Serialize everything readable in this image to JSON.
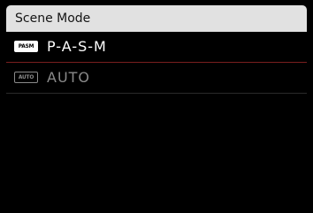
{
  "menu": {
    "title": "Scene Mode",
    "items": [
      {
        "icon": "PASM",
        "label": "P-A-S-M",
        "selected": true
      },
      {
        "icon": "AUTO",
        "label": "AUTO",
        "selected": false
      }
    ]
  },
  "colors": {
    "header_bg": "#e1e1e1",
    "background": "#000000",
    "selected_text": "#ffffff",
    "unselected_text": "#8a8a8a",
    "selection_rule": "#7a1f1f"
  }
}
